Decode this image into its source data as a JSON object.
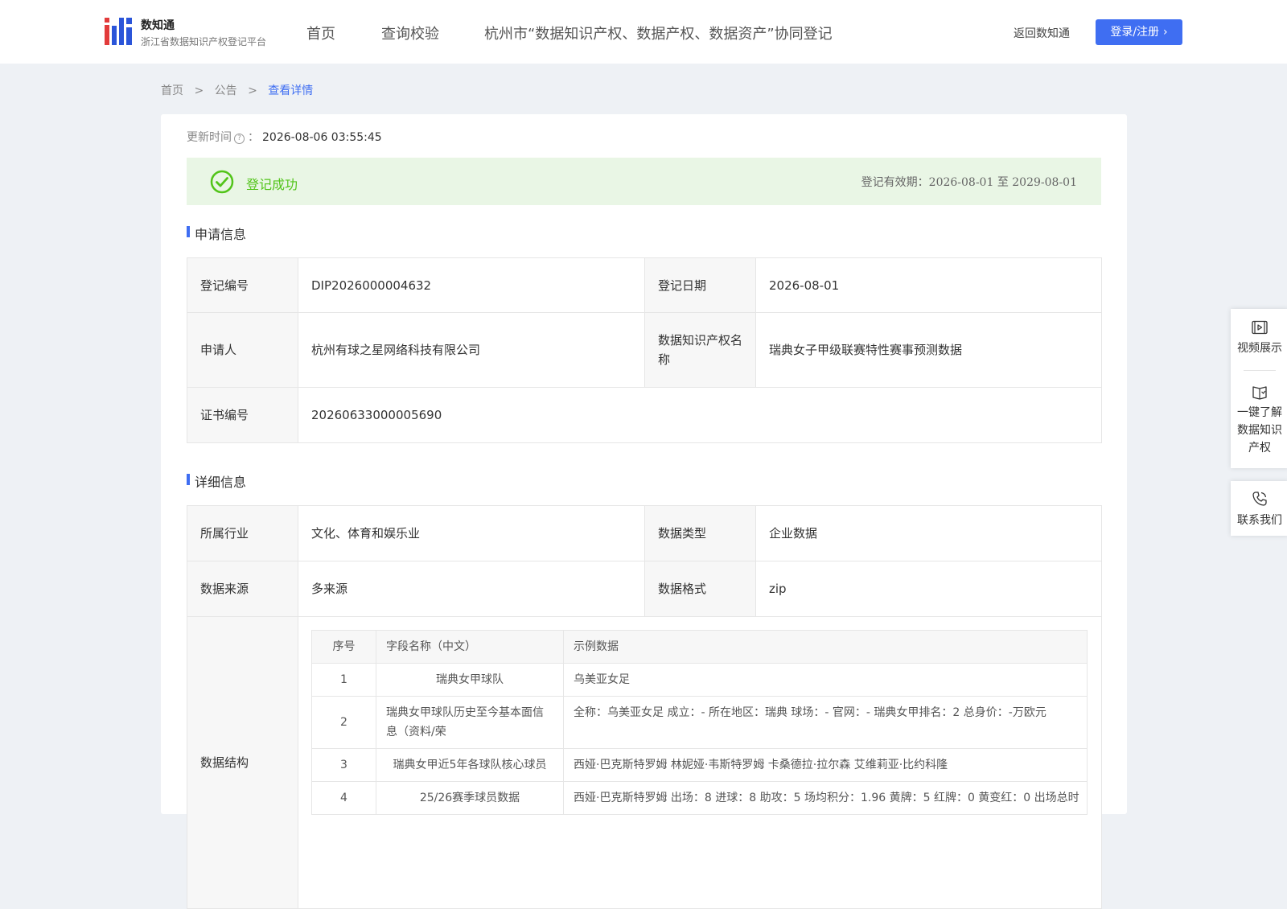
{
  "header": {
    "logo_title": "数知通",
    "logo_subtitle": "浙江省数据知识产权登记平台",
    "nav": [
      "首页",
      "查询校验",
      "杭州市“数据知识产权、数据产权、数据资产”协同登记"
    ],
    "back_link": "返回数知通",
    "login_button": "登录/注册"
  },
  "breadcrumb": [
    "首页",
    "公告",
    "查看详情"
  ],
  "update": {
    "label": "更新时间",
    "colon": "：",
    "value": "2026-08-06 03:55:45"
  },
  "status": {
    "text": "登记成功",
    "validity": "登记有效期：2026-08-01 至 2029-08-01",
    "color": "#52c41a"
  },
  "application": {
    "title": "申请信息",
    "reg_no_label": "登记编号",
    "reg_no": "DIP2026000004632",
    "reg_date_label": "登记日期",
    "reg_date": "2026-08-01",
    "applicant_label": "申请人",
    "applicant": "杭州有球之星网络科技有限公司",
    "ip_name_label": "数据知识产权名称",
    "ip_name": "瑞典女子甲级联赛特性赛事预测数据",
    "cert_no_label": "证书编号",
    "cert_no": "20260633000005690"
  },
  "details": {
    "title": "详细信息",
    "industry_label": "所属行业",
    "industry": "文化、体育和娱乐业",
    "data_type_label": "数据类型",
    "data_type": "企业数据",
    "source_label": "数据来源",
    "source": "多来源",
    "format_label": "数据格式",
    "format": "zip",
    "structure_label": "数据结构",
    "structure": {
      "headers": [
        "序号",
        "字段名称（中文）",
        "示例数据"
      ],
      "rows": [
        {
          "no": "1",
          "field": "瑞典女甲球队",
          "sample": "乌美亚女足"
        },
        {
          "no": "2",
          "field": "瑞典女甲球队历史至今基本面信息（资料/荣",
          "sample": "全称：乌美亚女足 成立：- 所在地区：瑞典 球场：- 官网：- 瑞典女甲排名：2 总身价：-万欧元"
        },
        {
          "no": "3",
          "field": "瑞典女甲近5年各球队核心球员",
          "sample": "西娅·巴克斯特罗姆 林妮娅·韦斯特罗姆 卡桑德拉·拉尔森 艾维莉亚·比约科隆"
        },
        {
          "no": "4",
          "field": "25/26赛季球员数据",
          "sample": "西娅·巴克斯特罗姆 出场：8 进球：8 助攻：5 场均积分：1.96 黄牌：5 红牌：0 黄变红：0 出场总时"
        }
      ]
    }
  },
  "side_panel": {
    "video": "视频展示",
    "learn": "一键了解数据知识产权",
    "contact": "联系我们"
  },
  "colors": {
    "accent": "#3f6ef2",
    "success_bg": "#e9f6e5"
  }
}
